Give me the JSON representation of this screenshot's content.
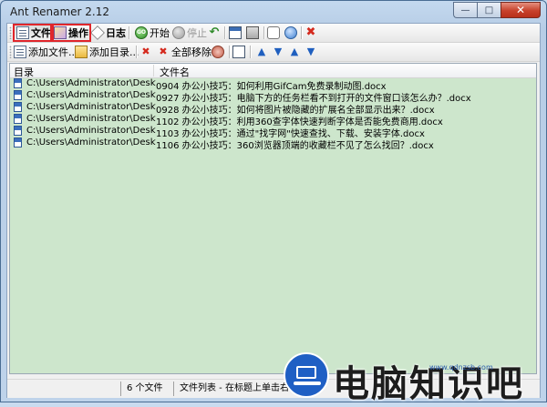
{
  "window": {
    "title": "Ant Renamer 2.12",
    "close_glyph": "✕",
    "min_glyph": "—",
    "max_glyph": "□"
  },
  "toolbar1": {
    "files_label": "文件",
    "actions_label": "操作",
    "log_label": "日志",
    "start_label": "开始",
    "stop_label": "停止",
    "go_icon_text": "GO"
  },
  "toolbar2": {
    "add_files_label": "添加文件...",
    "add_folders_label": "添加目录...",
    "remove_all_label": "全部移除",
    "arrows": [
      "▲",
      "▼",
      "▲",
      "▼"
    ]
  },
  "list": {
    "columns": [
      "目录",
      "文件名"
    ],
    "rows": [
      {
        "dir": "C:\\Users\\Administrator\\Desktop\\...",
        "name": "0904  办公小技巧：如何利用GifCam免费录制动图.docx"
      },
      {
        "dir": "C:\\Users\\Administrator\\Desktop\\...",
        "name": "0927  办公小技巧：电脑下方的任务栏看不到打开的文件窗口该怎么办？.docx"
      },
      {
        "dir": "C:\\Users\\Administrator\\Desktop\\...",
        "name": "0928  办公小技巧：如何将图片被隐藏的扩展名全部显示出来？.docx"
      },
      {
        "dir": "C:\\Users\\Administrator\\Desktop\\...",
        "name": "1102  办公小技巧：利用360查字体快速判断字体是否能免费商用.docx"
      },
      {
        "dir": "C:\\Users\\Administrator\\Desktop\\...",
        "name": "1103  办公小技巧：通过\"找字网\"快速查找、下载、安装字体.docx"
      },
      {
        "dir": "C:\\Users\\Administrator\\Desktop\\...",
        "name": "1106  办公小技巧：360浏览器顶端的收藏栏不见了怎么找回？.docx"
      }
    ]
  },
  "status": {
    "count": "6 个文件",
    "hint": "文件列表 - 在标题上单击右键"
  },
  "watermark": {
    "text": "电脑知识吧",
    "small": "www.qdnzsb.com"
  },
  "colors": {
    "list_bg": "#cde6cc",
    "highlight_box": "#e0262b",
    "title_bg": "#c4d9ef"
  }
}
